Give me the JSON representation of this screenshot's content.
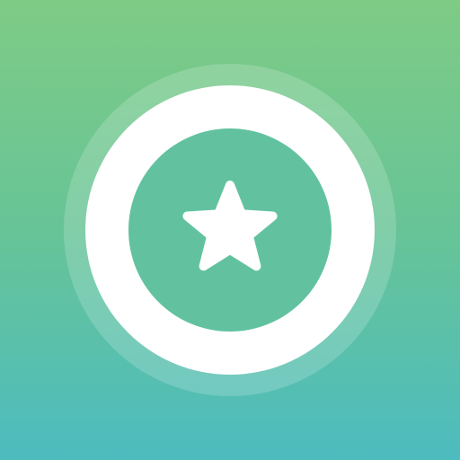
{
  "app_icon": {
    "icon_name": "star-in-ring-icon",
    "colors": {
      "background_top": "#7ecb85",
      "background_bottom": "#4dbcbf",
      "ring": "#ffffff",
      "halo": "#ffffff",
      "inner_disc": "#62c2a0",
      "star": "#ffffff"
    }
  }
}
